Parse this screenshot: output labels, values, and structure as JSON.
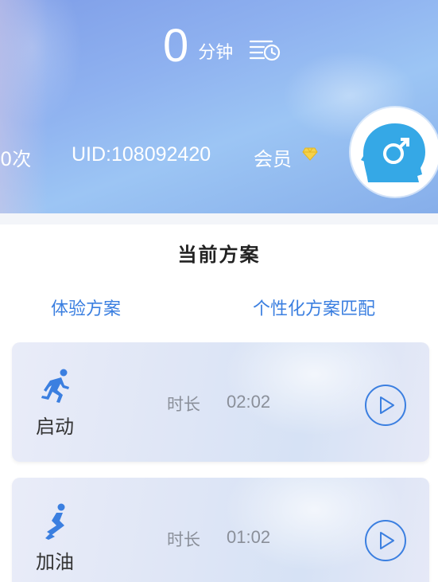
{
  "header": {
    "minutes_value": "0",
    "minutes_unit": "分钟",
    "count_text": "0次",
    "uid_text": "UID:108092420",
    "member_label": "会员",
    "history_icon": "history-list-icon",
    "diamond_icon": "diamond-icon",
    "avatar_icon": "male-head-icon"
  },
  "plan": {
    "title": "当前方案",
    "tabs": [
      {
        "label": "体验方案"
      },
      {
        "label": "个性化方案匹配"
      }
    ],
    "cards": [
      {
        "label": "启动",
        "duration_label": "时长",
        "duration": "02:02",
        "icon": "running-icon"
      },
      {
        "label": "加油",
        "duration_label": "时长",
        "duration": "01:02",
        "icon": "jump-icon"
      }
    ]
  },
  "colors": {
    "accent": "#3b7fe0",
    "header": "#8fb2f0",
    "avatar": "#35a8e6",
    "muted_text": "#8a8f99"
  }
}
